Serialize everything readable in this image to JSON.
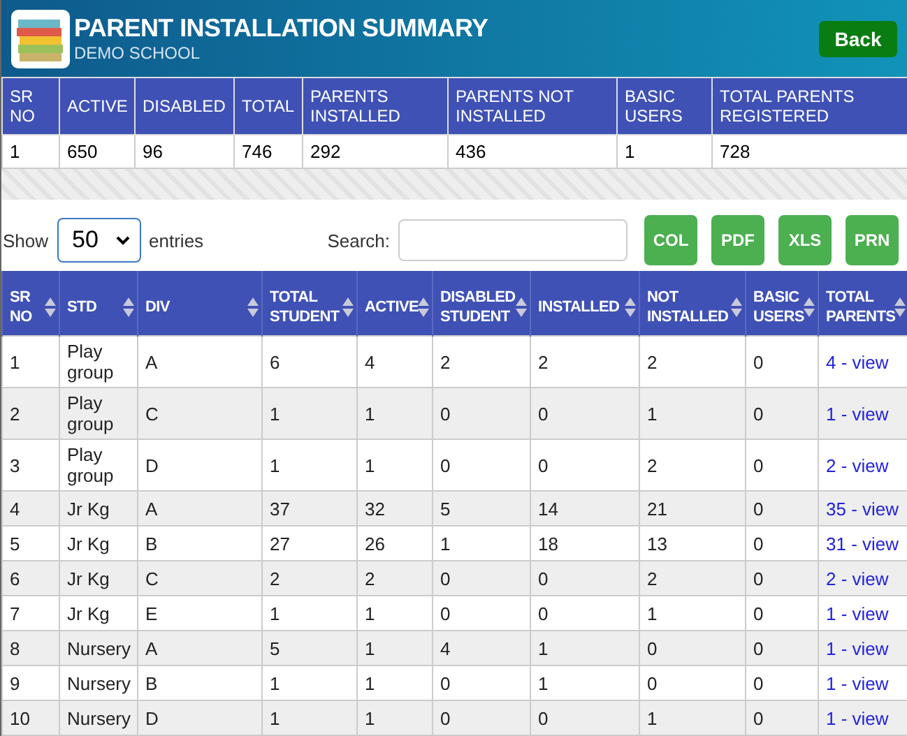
{
  "header": {
    "title": "PARENT INSTALLATION SUMMARY",
    "subtitle": "DEMO SCHOOL",
    "back_button": "Back"
  },
  "summary": {
    "columns": [
      "SR NO",
      "ACTIVE",
      "DISABLED",
      "TOTAL",
      "PARENTS INSTALLED",
      "PARENTS NOT INSTALLED",
      "BASIC USERS",
      "TOTAL PARENTS REGISTERED"
    ],
    "rows": [
      [
        "1",
        "650",
        "96",
        "746",
        "292",
        "436",
        "1",
        "728"
      ]
    ]
  },
  "controls": {
    "show_label": "Show",
    "page_size": "50",
    "entries_label": "entries",
    "search_label": "Search:",
    "buttons": [
      "COL",
      "PDF",
      "XLS",
      "PRN"
    ]
  },
  "table": {
    "columns": [
      "SR NO",
      "STD",
      "DIV",
      "TOTAL STUDENT",
      "ACTIVE",
      "DISABLED STUDENT",
      "INSTALLED",
      "NOT INSTALLED",
      "BASIC USERS",
      "TOTAL PARENTS"
    ],
    "rows": [
      [
        "1",
        "Play group",
        "A",
        "6",
        "4",
        "2",
        "2",
        "2",
        "0",
        "4 - view"
      ],
      [
        "2",
        "Play group",
        "C",
        "1",
        "1",
        "0",
        "0",
        "1",
        "0",
        "1 - view"
      ],
      [
        "3",
        "Play group",
        "D",
        "1",
        "1",
        "0",
        "0",
        "2",
        "0",
        "2 - view"
      ],
      [
        "4",
        "Jr Kg",
        "A",
        "37",
        "32",
        "5",
        "14",
        "21",
        "0",
        "35 - view"
      ],
      [
        "5",
        "Jr Kg",
        "B",
        "27",
        "26",
        "1",
        "18",
        "13",
        "0",
        "31 - view"
      ],
      [
        "6",
        "Jr Kg",
        "C",
        "2",
        "2",
        "0",
        "0",
        "2",
        "0",
        "2 - view"
      ],
      [
        "7",
        "Jr Kg",
        "E",
        "1",
        "1",
        "0",
        "0",
        "1",
        "0",
        "1 - view"
      ],
      [
        "8",
        "Nursery",
        "A",
        "5",
        "1",
        "4",
        "1",
        "0",
        "0",
        "1 - view"
      ],
      [
        "9",
        "Nursery",
        "B",
        "1",
        "1",
        "0",
        "1",
        "0",
        "0",
        "1 - view"
      ],
      [
        "10",
        "Nursery",
        "D",
        "1",
        "1",
        "0",
        "0",
        "1",
        "0",
        "1 - view"
      ]
    ]
  }
}
